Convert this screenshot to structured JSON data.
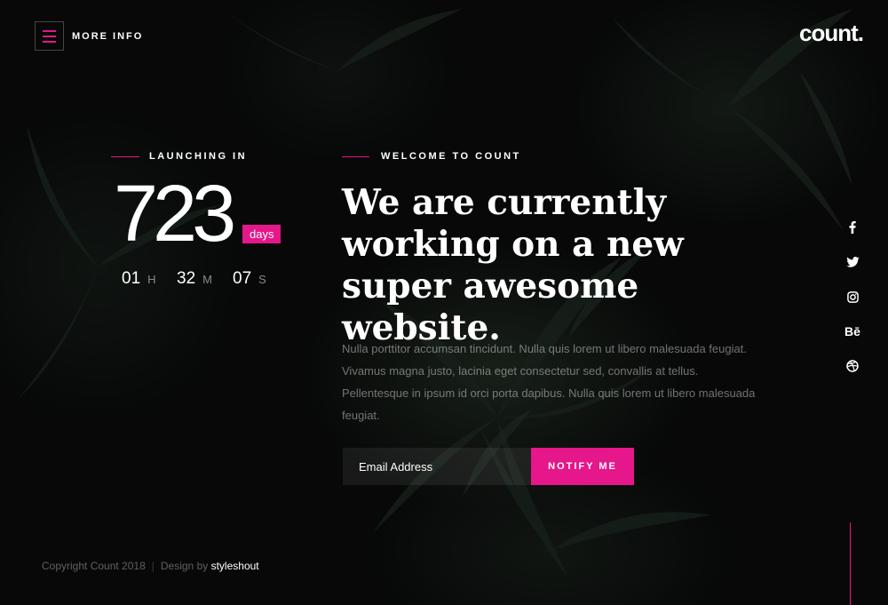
{
  "header": {
    "menu_label": "MORE INFO",
    "logo": "count."
  },
  "countdown": {
    "label": "LAUNCHING IN",
    "days": "723",
    "days_unit": "days",
    "hours": "01",
    "hours_unit": "H",
    "minutes": "32",
    "minutes_unit": "M",
    "seconds": "07",
    "seconds_unit": "S"
  },
  "main": {
    "label": "WELCOME TO COUNT",
    "headline": "We are currently working on a new super awesome website.",
    "description": "Nulla porttitor accumsan tincidunt. Nulla quis lorem ut libero malesuada feugiat. Vivamus magna justo, lacinia eget consectetur sed, convallis at tellus. Pellentesque in ipsum id orci porta dapibus. Nulla quis lorem ut libero malesuada feugiat."
  },
  "form": {
    "email_placeholder": "Email Address",
    "submit_label": "NOTIFY ME"
  },
  "social": {
    "icons": [
      "facebook-icon",
      "twitter-icon",
      "instagram-icon",
      "behance-icon",
      "dribbble-icon"
    ],
    "behance_glyph": "Bē"
  },
  "footer": {
    "copyright": "Copyright Count 2018",
    "separator": "|",
    "design_by": "Design by",
    "author": "styleshout"
  },
  "colors": {
    "accent": "#e5178a",
    "background": "#0b0d0c"
  }
}
